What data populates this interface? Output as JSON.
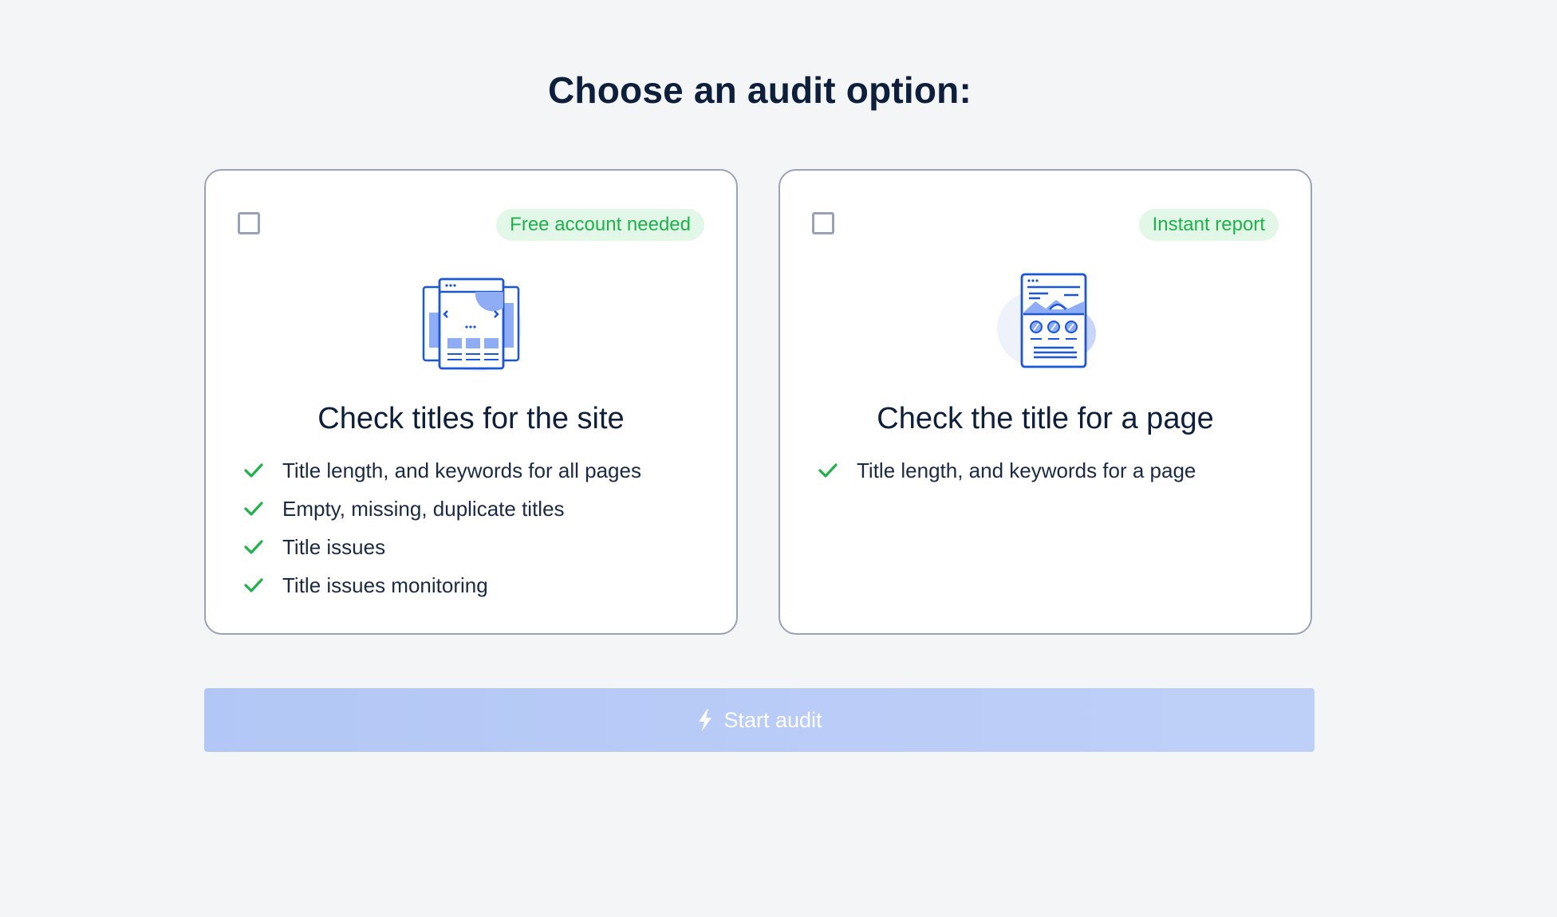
{
  "page": {
    "title": "Choose an audit option:"
  },
  "options": [
    {
      "badge": "Free account needed",
      "title": "Check titles for the site",
      "icon": "multi-page-site-icon",
      "features": [
        "Title length, and keywords for all pages",
        "Empty, missing, duplicate titles",
        "Title issues",
        "Title issues monitoring"
      ],
      "checked": false
    },
    {
      "badge": "Instant report",
      "title": "Check the title for a page",
      "icon": "single-page-icon",
      "features": [
        "Title length, and keywords for a page"
      ],
      "checked": false
    }
  ],
  "start_button": {
    "label": "Start audit",
    "icon": "lightning-bolt-icon",
    "enabled": false
  },
  "colors": {
    "background": "#f4f5f7",
    "heading": "#0d1f3a",
    "card_border": "#9aa3b5",
    "badge_bg": "#e3f7e8",
    "badge_text": "#1db24a",
    "check": "#1db24a",
    "icon_blue": "#1a56db",
    "icon_light": "#b9c8f7",
    "button_disabled": "#b7caf6"
  }
}
